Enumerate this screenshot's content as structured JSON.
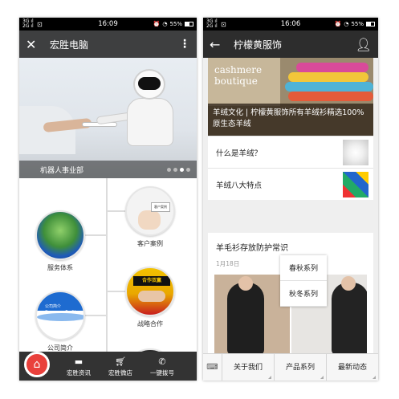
{
  "left_phone": {
    "status": {
      "signal": "3G ıl\n2G ıl",
      "sim": "⊡",
      "time": "16:09",
      "battery": "55%"
    },
    "title": "宏胜电脑",
    "banner": {
      "caption": "机器人事业部",
      "dot_count": 4,
      "active_dot": 2
    },
    "nodes": {
      "service": "服务体系",
      "case": "客户案例",
      "case_card": "客户案例",
      "strategy": "战略合作",
      "strategy_sign": "合作双赢",
      "profile": "公司简介",
      "profile_line1": "公司简介",
      "profile_line2": "Company Profile"
    },
    "nav": {
      "home_icon": "home-icon",
      "items": [
        {
          "label": "宏胜资讯",
          "icon": "chat-icon"
        },
        {
          "label": "宏胜微店",
          "icon": "cart-icon"
        },
        {
          "label": "一键拨号",
          "icon": "phone-icon"
        }
      ]
    }
  },
  "right_phone": {
    "status": {
      "signal": "3G ıl\n2G ıl",
      "sim": "⊡",
      "time": "16:06",
      "battery": "55%"
    },
    "title": "柠檬黄服饰",
    "hero": {
      "brand_line1": "the",
      "brand_line2": "cashmere",
      "brand_line3": "boutique",
      "caption": "羊绒文化 | 柠檬黄服饰所有羊绒衫精选100%原生态羊绒"
    },
    "rows": [
      {
        "label": "什么是羊绒？"
      },
      {
        "label": "羊绒八大特点"
      }
    ],
    "article": {
      "title": "羊毛衫存放防护常识",
      "date": "1月18日"
    },
    "submenu": [
      "春秋系列",
      "秋冬系列"
    ],
    "menubar": [
      "关于我们",
      "产品系列",
      "最新动态"
    ]
  }
}
